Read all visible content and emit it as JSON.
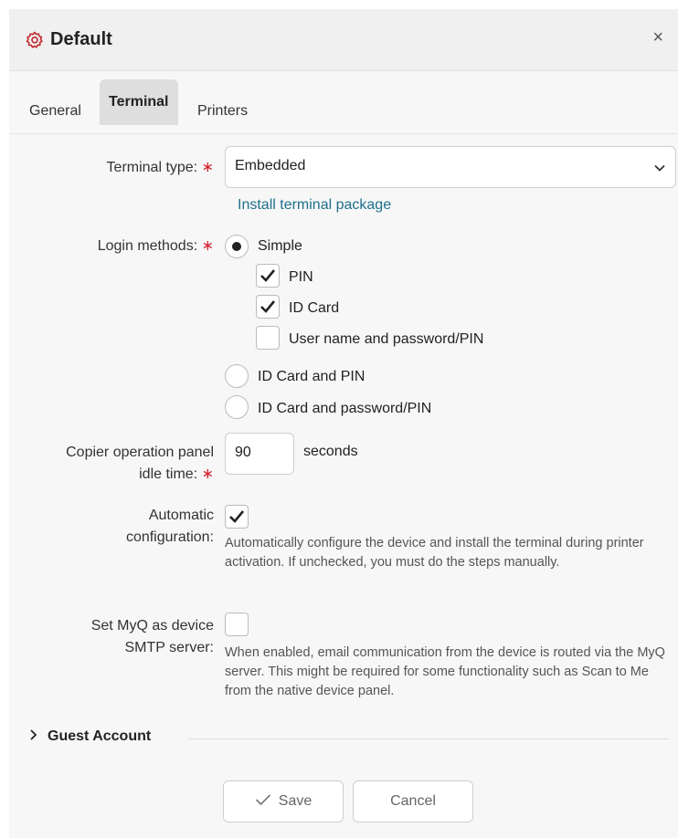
{
  "header": {
    "title": "Default",
    "close_glyph": "×",
    "icon": "gear-icon",
    "accent_color": "#c0272d"
  },
  "tabs": [
    {
      "label": "General",
      "active": false
    },
    {
      "label": "Terminal",
      "active": true
    },
    {
      "label": "Printers",
      "active": false
    }
  ],
  "terminal_type": {
    "label": "Terminal type:",
    "required": "∗",
    "value": "Embedded"
  },
  "install_link": "Install terminal package",
  "login_methods": {
    "label": "Login methods:",
    "required": "∗",
    "options": [
      {
        "label": "Simple",
        "selected": true
      },
      {
        "label": "ID Card and PIN",
        "selected": false
      },
      {
        "label": "ID Card and password/PIN",
        "selected": false
      }
    ],
    "simple_sub": [
      {
        "label": "PIN",
        "checked": true
      },
      {
        "label": "ID Card",
        "checked": true
      },
      {
        "label": "User name and password/PIN",
        "checked": false
      }
    ]
  },
  "idle_time": {
    "label_line1": "Copier operation panel",
    "label_line2": "idle time:",
    "required": "∗",
    "value": "90",
    "unit": "seconds"
  },
  "auto_config": {
    "label_line1": "Automatic",
    "label_line2": "configuration:",
    "checked": true,
    "help": "Automatically configure the device and install the terminal during printer activation. If unchecked, you must do the steps manually."
  },
  "smtp": {
    "label_line1": "Set MyQ as device",
    "label_line2": "SMTP server:",
    "checked": false,
    "help": "When enabled, email communication from the device is routed via the MyQ server. This might be required for some functionality such as Scan to Me from the native device panel."
  },
  "guest_account": {
    "label": "Guest Account"
  },
  "buttons": {
    "save": "Save",
    "cancel": "Cancel"
  }
}
